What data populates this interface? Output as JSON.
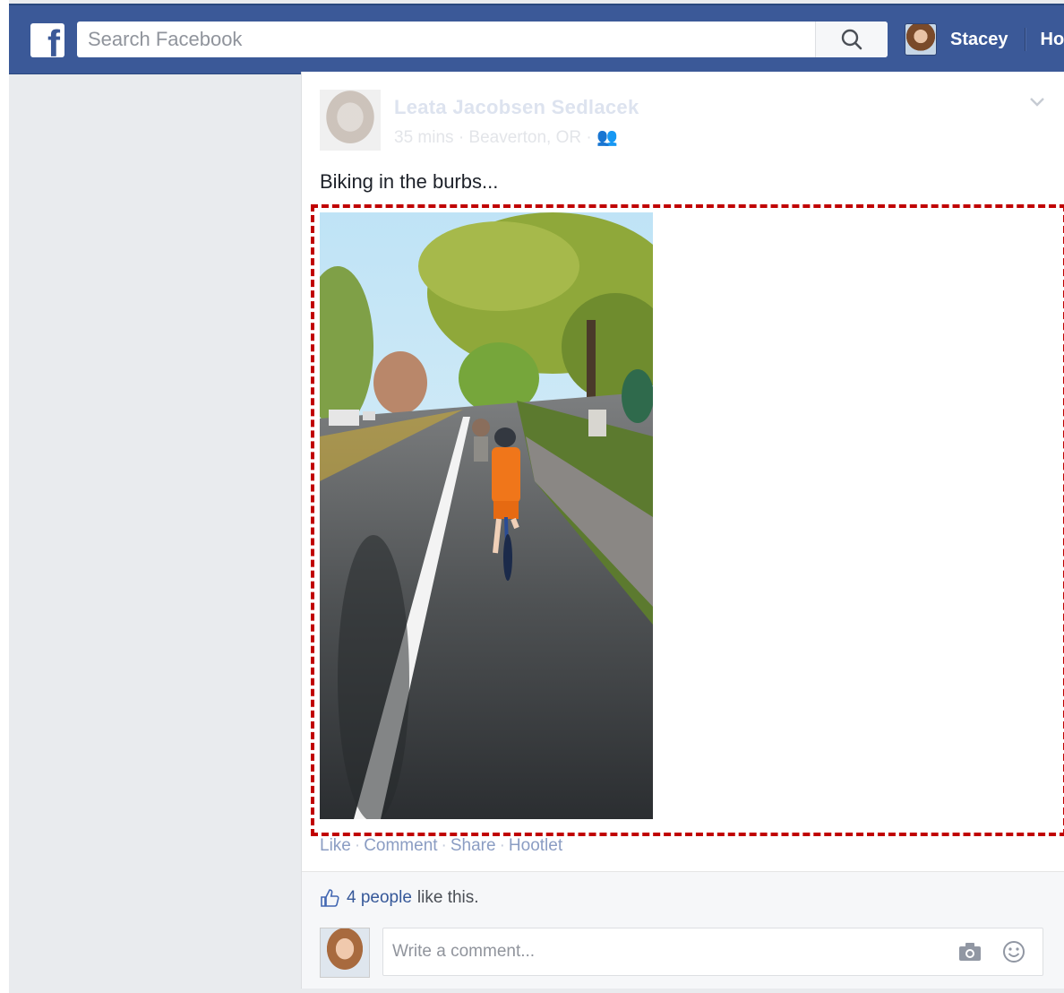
{
  "topbar": {
    "logo_letter": "f",
    "search_placeholder": "Search Facebook",
    "user_name": "Stacey",
    "nav_home": "Ho"
  },
  "post": {
    "author": "Leata Jacobsen Sedlacek",
    "time": "35 mins",
    "location": "Beaverton, OR",
    "friends_icon": "👥",
    "text": "Biking in the burbs...",
    "actions": [
      "Like",
      "Comment",
      "Share",
      "Hootlet"
    ],
    "likes_count_text": "4 people",
    "likes_rest_text": "like this.",
    "comment_placeholder": "Write a comment..."
  },
  "colors": {
    "brand": "#3b5998",
    "highlight": "#c00000"
  }
}
